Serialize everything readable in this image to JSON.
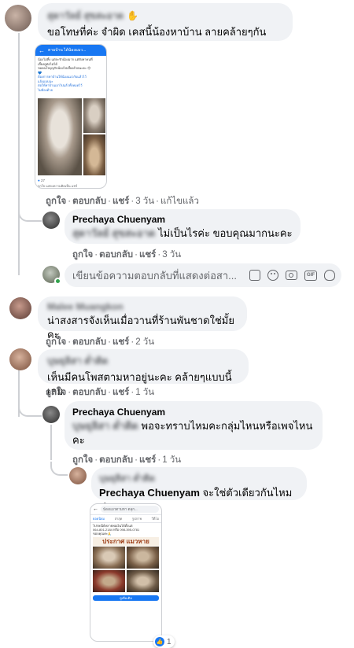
{
  "comment1": {
    "name": "สุดาวัลย์ สุขสะอาด",
    "text": "ขอโทษที่ค่ะ จำผิด เคสนี้น้องหาบ้าน ลายคล้ายๆกัน",
    "screenshot": {
      "header": "ตามบ้าน ได้น้องแมว...",
      "lines": [
        "น้องไม่ทิ้ง แต่จะรักน้องมาก แต่ยังหาคนที่",
        "เลี้ยงดูต่อไม่ได้",
        "ขอคนใจบุญรับน้องไปเลี้ยงด้วยนะคะ 😢",
        "💙",
        "ต้องการหาบ้านให้น้องแมวกับแล้วไว้",
        "แจ้งแบบนะ",
        "ต่อให้หาบ้านเอาไปแล้วทั้งหมดไว้",
        "ไม่ต้องด้วย"
      ],
      "reactions": "27",
      "footer": "ถูกใจ  แสดงความคิดเห็น  แชร์"
    },
    "actions": {
      "like": "ถูกใจ",
      "reply": "ตอบกลับ",
      "share": "แชร์",
      "time": "3 วัน",
      "edited": "แก้ไขแล้ว"
    }
  },
  "reply1": {
    "name": "Prechaya Chuenyam",
    "mention": "สุดาวัลย์ สุขสะอาด",
    "text": "ไม่เป็นไรค่ะ ขอบคุณมากนะคะ",
    "actions": {
      "like": "ถูกใจ",
      "reply": "ตอบกลับ",
      "share": "แชร์",
      "time": "3 วัน"
    }
  },
  "reply_input": {
    "placeholder": "เขียนข้อความตอบกลับที่แสดงต่อสา..."
  },
  "comment2": {
    "name": "Malee Muangkon",
    "text": "น่าสงสารจังเห็นเมื่อวานที่ร้านพันชาดใช่มั้ยคะ",
    "actions": {
      "like": "ถูกใจ",
      "reply": "ตอบกลับ",
      "share": "แชร์",
      "time": "2 วัน"
    }
  },
  "comment3": {
    "name": "บุษยุลิสา ต่ำติด",
    "text": "เห็นมีคนโพสตามหาอยู่นะคะ คล้ายๆแบบนี้เลย",
    "actions": {
      "like": "ถูกใจ",
      "reply": "ตอบกลับ",
      "share": "แชร์",
      "time": "1 วัน"
    }
  },
  "reply2": {
    "name": "Prechaya Chuenyam",
    "mention": "บุษยุลิสา ต่ำติด",
    "text": "พอจะทราบไหมคะกลุ่มไหนหรือเพจไหนคะ",
    "actions": {
      "like": "ถูกใจ",
      "reply": "ตอบกลับ",
      "share": "แชร์",
      "time": "1 วัน"
    }
  },
  "reply3": {
    "name": "บุษยุลิสา ต่ำติด",
    "mention": "Prechaya Chuenyam",
    "text": "จะใช่ตัวเดียวกันไหมค่ะ",
    "screenshot": {
      "search": "น้องแมวตามหา ตลุก...",
      "tabs": [
        "ยอดนิยม",
        "ล่าสุด",
        "รูปภาพ",
        "วิดีโอ"
      ],
      "lines": [
        "ไปรษณีย์หลายพอเงินได้ตั้งแต่",
        "064-801-2184 หรือ 098-395-0781",
        "ขอบคุณค่ะ🙏"
      ],
      "banner": "ประกาศ แมวหาย",
      "button": "ดูเพิ่มเติม"
    },
    "reaction_count": "1"
  },
  "colors": {
    "bubble": "#f0f2f5",
    "link": "#216fdb",
    "muted": "#65676b",
    "online": "#31a24c"
  }
}
